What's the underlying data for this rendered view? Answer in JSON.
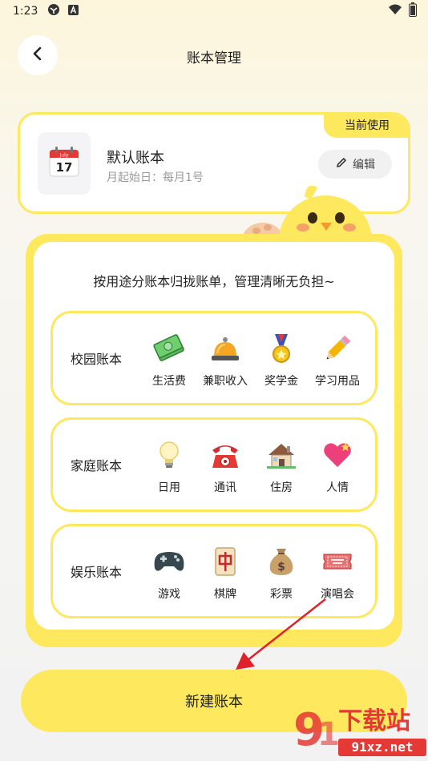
{
  "status_bar": {
    "time": "1:23"
  },
  "header": {
    "title": "账本管理"
  },
  "default_book": {
    "badge": "当前使用",
    "calendar_month": "July",
    "calendar_day": "17",
    "name": "默认账本",
    "subtitle": "月起始日：每月1号",
    "edit_label": "编辑"
  },
  "templates": {
    "heading": "按用途分账本归拢账单，管理清晰无负担~",
    "books": [
      {
        "title": "校园账本",
        "categories": [
          {
            "label": "生活费",
            "icon": "money-icon"
          },
          {
            "label": "兼职收入",
            "icon": "bell-icon"
          },
          {
            "label": "奖学金",
            "icon": "medal-icon"
          },
          {
            "label": "学习用品",
            "icon": "pencil-icon"
          }
        ]
      },
      {
        "title": "家庭账本",
        "categories": [
          {
            "label": "日用",
            "icon": "lightbulb-icon"
          },
          {
            "label": "通讯",
            "icon": "telephone-icon"
          },
          {
            "label": "住房",
            "icon": "house-icon"
          },
          {
            "label": "人情",
            "icon": "heart-icon"
          }
        ]
      },
      {
        "title": "娱乐账本",
        "categories": [
          {
            "label": "游戏",
            "icon": "gamepad-icon"
          },
          {
            "label": "棋牌",
            "icon": "mahjong-icon"
          },
          {
            "label": "彩票",
            "icon": "money-bag-icon"
          },
          {
            "label": "演唱会",
            "icon": "ticket-icon"
          }
        ]
      }
    ]
  },
  "create_button": {
    "label": "新建账本"
  },
  "watermark": {
    "text": "下载站",
    "url_text": "91xz.net"
  },
  "colors": {
    "accent": "#fde85e",
    "arrow": "#e0202a"
  }
}
